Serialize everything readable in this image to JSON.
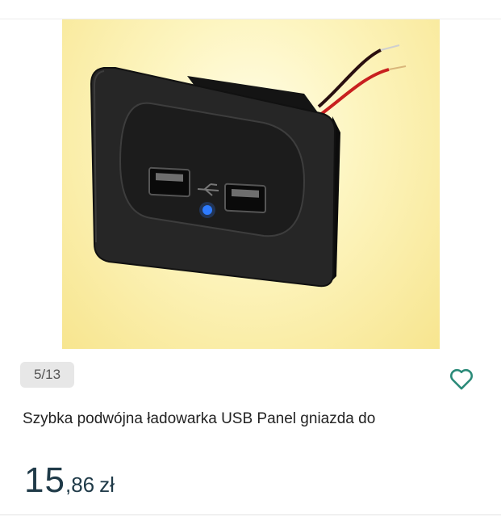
{
  "gallery": {
    "image_alt": "USB charger socket panel",
    "counter": "5/13"
  },
  "product": {
    "title": "Szybka podwójna ładowarka USB Panel gniazda do",
    "price_integer": "15",
    "price_separator": ",",
    "price_decimal": "86",
    "price_currency": "zł"
  },
  "icons": {
    "favorite": "heart-outline-icon",
    "usb_symbol": "usb-icon"
  },
  "colors": {
    "accent": "#2a8a78",
    "price": "#1f3a48",
    "image_background": "#f9e9a2"
  }
}
